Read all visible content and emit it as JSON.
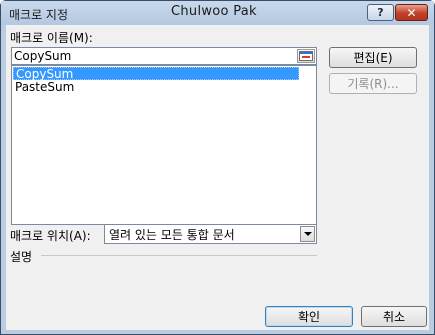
{
  "window": {
    "title": "매크로 지정",
    "owner": "Chulwoo Pak",
    "help_label": "?",
    "close_label": "✕"
  },
  "macro_name": {
    "label": "매크로 이름(M):",
    "value": "CopySum"
  },
  "macro_list": {
    "items": [
      {
        "label": "CopySum",
        "selected": true
      },
      {
        "label": "PasteSum",
        "selected": false
      }
    ]
  },
  "buttons": {
    "edit": "편집(E)",
    "record": "기록(R)...",
    "ok": "확인",
    "cancel": "취소"
  },
  "macro_location": {
    "label": "매크로 위치(A):",
    "value": "열려 있는 모든 통합 문서"
  },
  "description": {
    "label": "설명"
  },
  "colors": {
    "frame": "#b9cce2",
    "selection": "#3399ff",
    "close_button": "#c2402a"
  },
  "icons": {
    "collapse_dialog": "collapse-dialog-icon",
    "dropdown": "chevron-down-icon"
  }
}
